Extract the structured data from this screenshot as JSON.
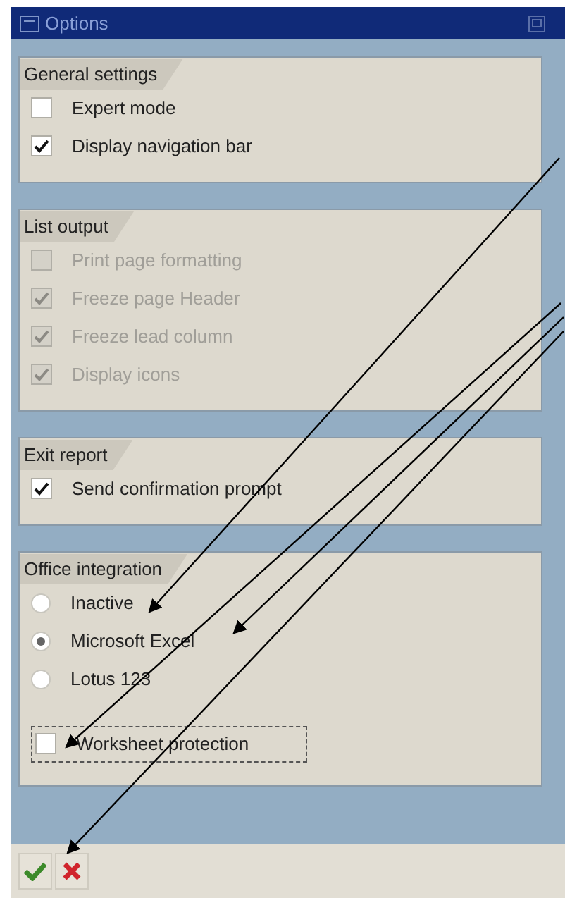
{
  "window": {
    "title": "Options"
  },
  "groups": [
    {
      "title": "General settings",
      "items": [
        {
          "kind": "checkbox",
          "label": "Expert mode",
          "checked": false,
          "disabled": false,
          "focused": false
        },
        {
          "kind": "checkbox",
          "label": "Display navigation bar",
          "checked": true,
          "disabled": false,
          "focused": false
        }
      ]
    },
    {
      "title": "List output",
      "items": [
        {
          "kind": "checkbox",
          "label": "Print page formatting",
          "checked": false,
          "disabled": true,
          "focused": false
        },
        {
          "kind": "checkbox",
          "label": "Freeze page Header",
          "checked": true,
          "disabled": true,
          "focused": false
        },
        {
          "kind": "checkbox",
          "label": "Freeze lead column",
          "checked": true,
          "disabled": true,
          "focused": false
        },
        {
          "kind": "checkbox",
          "label": "Display icons",
          "checked": true,
          "disabled": true,
          "focused": false
        }
      ]
    },
    {
      "title": "Exit report",
      "items": [
        {
          "kind": "checkbox",
          "label": "Send confirmation prompt",
          "checked": true,
          "disabled": false,
          "focused": false
        }
      ]
    },
    {
      "title": "Office integration",
      "items": [
        {
          "kind": "radio",
          "label": "Inactive",
          "selected": false,
          "disabled": false,
          "focused": false
        },
        {
          "kind": "radio",
          "label": "Microsoft Excel",
          "selected": true,
          "disabled": false,
          "focused": false
        },
        {
          "kind": "radio",
          "label": "Lotus 123",
          "selected": false,
          "disabled": false,
          "focused": false
        },
        {
          "kind": "spacer"
        },
        {
          "kind": "checkbox",
          "label": "Worksheet protection",
          "checked": false,
          "disabled": false,
          "focused": true
        }
      ]
    }
  ],
  "buttons": [
    {
      "kind": "confirm"
    },
    {
      "kind": "cancel"
    }
  ]
}
